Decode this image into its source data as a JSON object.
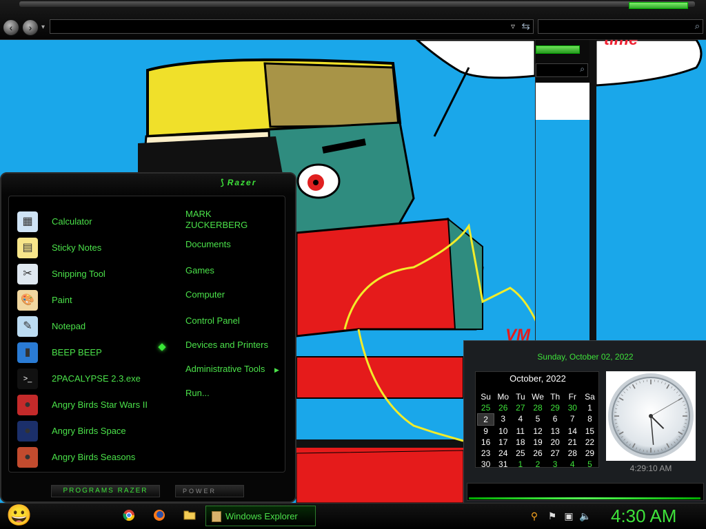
{
  "window": {
    "title": "Windows Explorer",
    "address_value": "",
    "search_placeholder": ""
  },
  "wallpaper": {
    "text_fragment": "VM",
    "bubble_text_fragment": "time"
  },
  "start_menu": {
    "brand": "Razer",
    "programs": [
      {
        "label": "Calculator",
        "icon": "calculator-icon"
      },
      {
        "label": "Sticky Notes",
        "icon": "sticky-notes-icon"
      },
      {
        "label": "Snipping Tool",
        "icon": "scissors-icon"
      },
      {
        "label": "Paint",
        "icon": "palette-icon"
      },
      {
        "label": "Notepad",
        "icon": "notepad-icon"
      },
      {
        "label": "BEEP BEEP",
        "icon": "beep-app-icon"
      },
      {
        "label": "2PACALYPSE 2.3.exe",
        "icon": "console-icon"
      },
      {
        "label": "Angry Birds Star Wars II",
        "icon": "angry-birds-star-wars-icon"
      },
      {
        "label": "Angry Birds Space",
        "icon": "angry-birds-space-icon"
      },
      {
        "label": "Angry Birds Seasons",
        "icon": "angry-birds-seasons-icon"
      }
    ],
    "places": {
      "user_line1": "MARK",
      "user_line2": "ZUCKERBERG",
      "documents": "Documents",
      "games": "Games",
      "computer": "Computer",
      "control_panel": "Control Panel",
      "devices": "Devices and Printers",
      "admin_tools": "Administrative Tools",
      "run": "Run..."
    },
    "all_programs_label": "PROGRAMS RAZER",
    "power_label": "POWER"
  },
  "gadget": {
    "date_long": "Sunday, October 02, 2022",
    "month_header": "October, 2022",
    "weekday_headers": [
      "Su",
      "Mo",
      "Tu",
      "We",
      "Th",
      "Fr",
      "Sa"
    ],
    "days": [
      {
        "d": "25",
        "out": true
      },
      {
        "d": "26",
        "out": true
      },
      {
        "d": "27",
        "out": true
      },
      {
        "d": "28",
        "out": true
      },
      {
        "d": "29",
        "out": true
      },
      {
        "d": "30",
        "out": true
      },
      {
        "d": "1",
        "out": false
      },
      {
        "d": "2",
        "out": false,
        "today": true
      },
      {
        "d": "3",
        "out": false
      },
      {
        "d": "4",
        "out": false
      },
      {
        "d": "5",
        "out": false
      },
      {
        "d": "6",
        "out": false
      },
      {
        "d": "7",
        "out": false
      },
      {
        "d": "8",
        "out": false
      },
      {
        "d": "9",
        "out": false
      },
      {
        "d": "10",
        "out": false
      },
      {
        "d": "11",
        "out": false
      },
      {
        "d": "12",
        "out": false
      },
      {
        "d": "13",
        "out": false
      },
      {
        "d": "14",
        "out": false
      },
      {
        "d": "15",
        "out": false
      },
      {
        "d": "16",
        "out": false
      },
      {
        "d": "17",
        "out": false
      },
      {
        "d": "18",
        "out": false
      },
      {
        "d": "19",
        "out": false
      },
      {
        "d": "20",
        "out": false
      },
      {
        "d": "21",
        "out": false
      },
      {
        "d": "22",
        "out": false
      },
      {
        "d": "23",
        "out": false
      },
      {
        "d": "24",
        "out": false
      },
      {
        "d": "25",
        "out": false
      },
      {
        "d": "26",
        "out": false
      },
      {
        "d": "27",
        "out": false
      },
      {
        "d": "28",
        "out": false
      },
      {
        "d": "29",
        "out": false
      },
      {
        "d": "30",
        "out": false
      },
      {
        "d": "31",
        "out": false
      },
      {
        "d": "1",
        "out": true
      },
      {
        "d": "2",
        "out": true
      },
      {
        "d": "3",
        "out": true
      },
      {
        "d": "4",
        "out": true
      },
      {
        "d": "5",
        "out": true
      }
    ],
    "clock_text": "4:29:10 AM",
    "clock_hours": 4,
    "clock_minutes": 29,
    "clock_seconds": 10
  },
  "taskbar": {
    "clock": "4:30 AM",
    "active_task": "Windows Explorer",
    "pinned": [
      "chrome-icon",
      "firefox-icon",
      "folder-icon"
    ],
    "tray": [
      "search-tray-icon",
      "action-center-flag-icon",
      "network-icon",
      "volume-icon"
    ]
  },
  "colors": {
    "accent": "#3ee23a",
    "wallpaper_blue": "#1aa7ea"
  }
}
